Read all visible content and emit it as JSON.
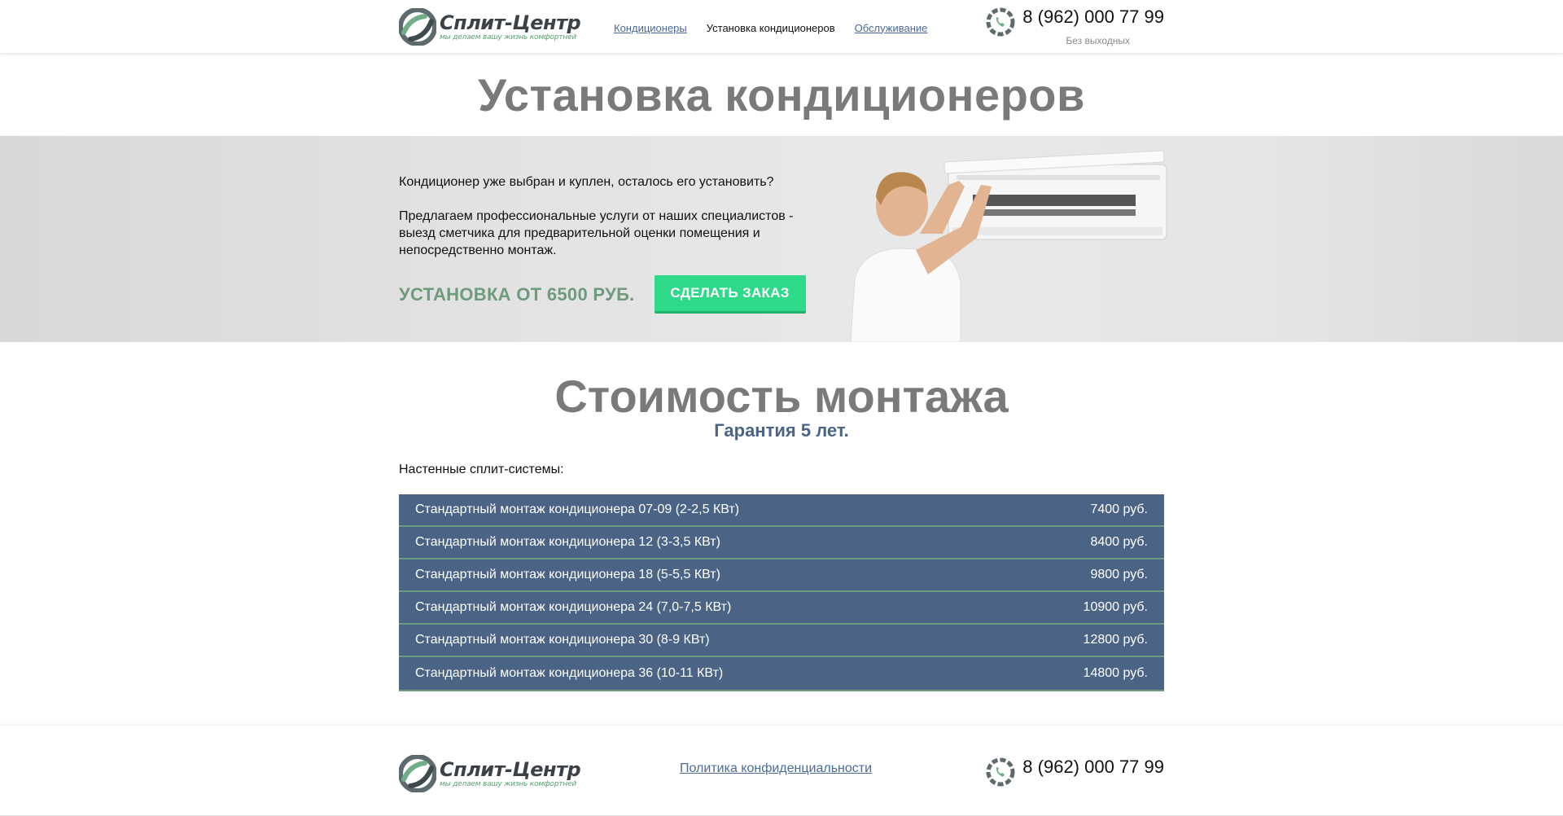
{
  "header": {
    "logo_name": "Сплит-Центр",
    "logo_slogan": "мы делаем вашу жизнь комфортней",
    "nav": [
      {
        "label": "Кондиционеры"
      },
      {
        "label": "Установка кондиционеров"
      },
      {
        "label": "Обслуживание"
      }
    ],
    "phone": "8 (962) 000 77 99",
    "phone_note": "Без выходных"
  },
  "page_title": "Установка кондиционеров",
  "hero": {
    "question": "Кондиционер уже выбран и куплен, осталось его установить?",
    "description": "Предлагаем профессиональные услуги от наших специалистов - выезд сметчика для предварительной оценки помещения и непосредственно монтаж.",
    "price_label": "УСТАНОВКА ОТ 6500 РУБ.",
    "order_button": "СДЕЛАТЬ ЗАКАЗ"
  },
  "cost": {
    "title": "Стоимость монтажа",
    "subtitle": "Гарантия 5 лет.",
    "category": "Настенные сплит-системы:",
    "rows": [
      {
        "name": "Стандартный монтаж кондиционера 07-09 (2-2,5 КВт)",
        "price": "7400 руб."
      },
      {
        "name": "Стандартный монтаж кондиционера 12 (3-3,5 КВт)",
        "price": "8400 руб."
      },
      {
        "name": "Стандартный монтаж кондиционера 18 (5-5,5 КВт)",
        "price": "9800 руб."
      },
      {
        "name": "Стандартный монтаж кондиционера 24 (7,0-7,5 КВт)",
        "price": "10900 руб."
      },
      {
        "name": "Стандартный монтаж кондиционера 30 (8-9 КВт)",
        "price": "12800 руб."
      },
      {
        "name": "Стандартный монтаж кондиционера 36 (10-11 КВт)",
        "price": "14800 руб."
      }
    ]
  },
  "footer": {
    "logo_name": "Сплит-Центр",
    "logo_slogan": "мы делаем вашу жизнь комфортней",
    "privacy_link": "Политика конфиденциальности",
    "phone": "8 (962) 000 77 99"
  },
  "colors": {
    "accent_green": "#2fd98a",
    "price_green": "#6e9b7c",
    "table_blue": "#4b6486",
    "link_blue": "#4a6a9a"
  }
}
